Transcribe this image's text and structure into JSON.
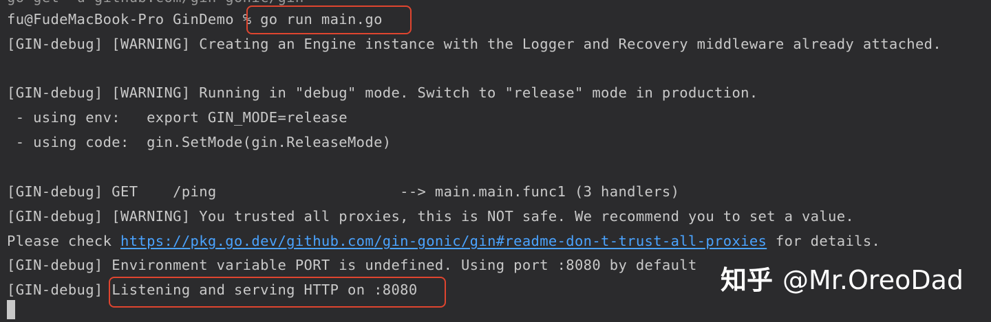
{
  "terminal": {
    "top_cut_line": "go get -u github.com/gin-gonic/gin",
    "prompt_user": "fu@FudeMacBook-Pro GinDemo ",
    "prompt_cmd": "% go run main.go",
    "lines": {
      "l1": "[GIN-debug] [WARNING] Creating an Engine instance with the Logger and Recovery middleware already attached.",
      "l2": "[GIN-debug] [WARNING] Running in \"debug\" mode. Switch to \"release\" mode in production.",
      "l3": " - using env:   export GIN_MODE=release",
      "l4": " - using code:  gin.SetMode(gin.ReleaseMode)",
      "l5": "[GIN-debug] GET    /ping                     --> main.main.func1 (3 handlers)",
      "l6": "[GIN-debug] [WARNING] You trusted all proxies, this is NOT safe. We recommend you to set a value.",
      "l7_prefix": "Please check ",
      "l7_link": "https://pkg.go.dev/github.com/gin-gonic/gin#readme-don-t-trust-all-proxies",
      "l7_suffix": " for details.",
      "l8": "[GIN-debug] Environment variable PORT is undefined. Using port :8080 by default",
      "l9_prefix": "[GIN-debug] ",
      "l9_highlight": "Listening and serving HTTP on :8080"
    }
  },
  "watermark": {
    "site": "知乎",
    "author": "@Mr.OreoDad"
  },
  "colors": {
    "background": "#2b2b2d",
    "text": "#c9c9c9",
    "link": "#4aa3ff",
    "highlight": "#e0452f"
  }
}
